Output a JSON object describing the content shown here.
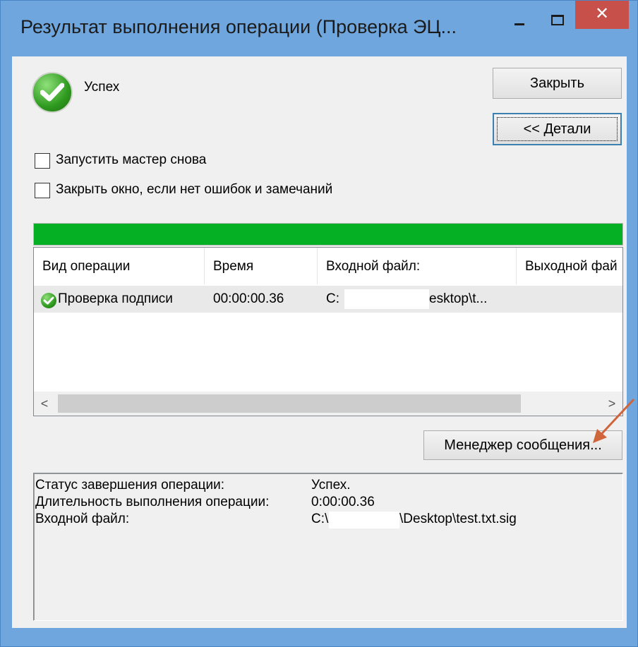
{
  "window": {
    "title": "Результат выполнения операции (Проверка ЭЦ...",
    "close_glyph": "✕"
  },
  "status": {
    "text": "Успех",
    "icon": "success-check-icon"
  },
  "buttons": {
    "close": "Закрыть",
    "details": "<< Детали",
    "message_manager": "Менеджер сообщения..."
  },
  "checkboxes": [
    {
      "label": "Запустить мастер снова",
      "checked": false
    },
    {
      "label": "Закрыть окно, если нет ошибок и замечаний",
      "checked": false
    }
  ],
  "progress": {
    "value": 100,
    "color": "#06b025"
  },
  "table": {
    "columns": [
      "Вид операции",
      "Время",
      "Входной файл:",
      "Выходной фай"
    ],
    "rows": [
      {
        "operation": "Проверка подписи",
        "time": "00:00:00.36",
        "input_prefix": "C:",
        "input_suffix": "esktop\\t..."
      }
    ]
  },
  "scrollbar": {
    "left_glyph": "<",
    "right_glyph": ">"
  },
  "details": {
    "lines": [
      {
        "label": "Статус завершения операции:",
        "value": "Успех."
      },
      {
        "label": "Длительность выполнения операции:",
        "value": "0:00:00.36"
      },
      {
        "label": "Входной файл:",
        "value_prefix": "C:\\",
        "value_suffix": "\\Desktop\\test.txt.sig"
      }
    ]
  },
  "colors": {
    "frame": "#6fa6dd",
    "close_button": "#c7504b",
    "annotation_arrow": "#d0643a"
  }
}
